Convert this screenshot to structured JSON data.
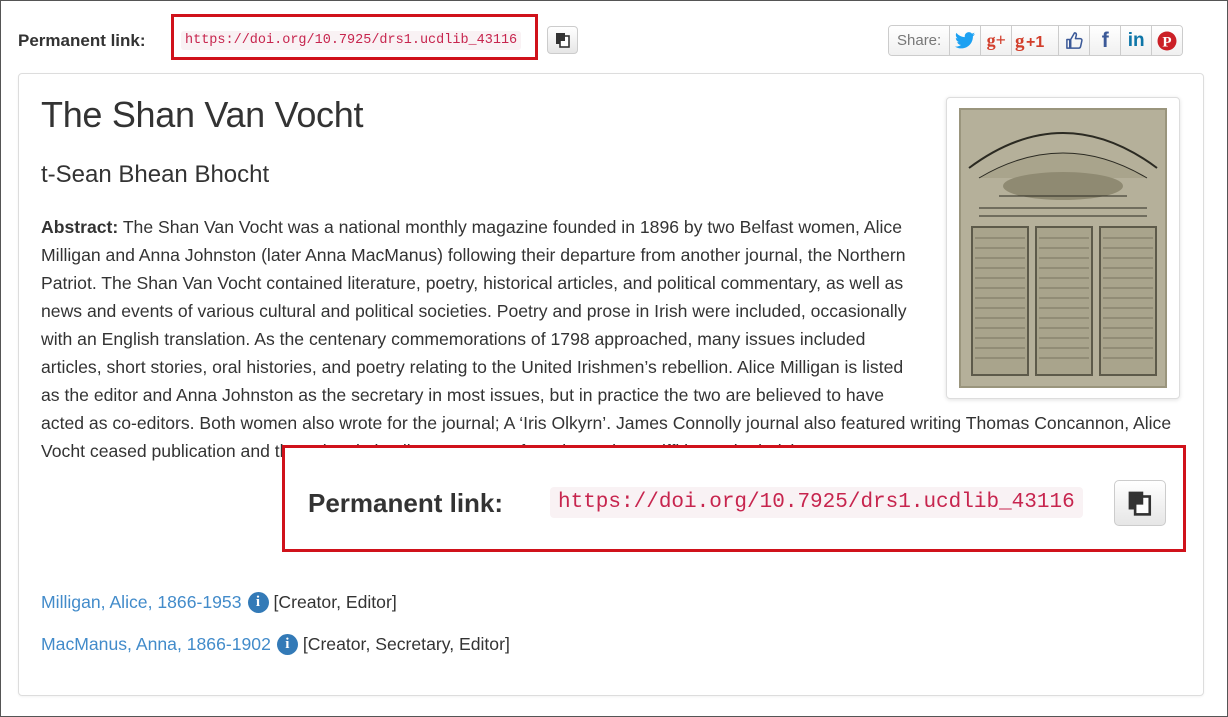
{
  "permalink": {
    "label": "Permanent link:",
    "url": "https://doi.org/10.7925/drs1.ucdlib_43116"
  },
  "share": {
    "label": "Share:",
    "buttons": [
      {
        "icon": "twitter-icon",
        "glyph": "",
        "color": "#1da1f2"
      },
      {
        "icon": "google-plus-icon",
        "glyph": "g+",
        "color": "#d23e2b"
      },
      {
        "icon": "google-plus-one-icon",
        "glyph": "+1",
        "color": "#d23e2b"
      },
      {
        "icon": "thumbs-up-icon",
        "glyph": "",
        "color": "#3b5998"
      },
      {
        "icon": "facebook-icon",
        "glyph": "f",
        "color": "#3b5998"
      },
      {
        "icon": "linkedin-icon",
        "glyph": "in",
        "color": "#0e76a8"
      },
      {
        "icon": "pinterest-icon",
        "glyph": "",
        "color": "#cb2027"
      }
    ]
  },
  "record": {
    "title": "The Shan Van Vocht",
    "subtitle": "t-Sean Bhean Bhocht",
    "abstract_label": "Abstract:",
    "abstract_text": "The Shan Van Vocht was a national monthly magazine founded in 1896 by two Belfast women, Alice Milligan and Anna Johnston (later Anna MacManus) following their departure from another journal, the Northern Patriot. The Shan Van Vocht contained literature, poetry, historical articles, and political commentary, as well as news and events of various cultural and political societies. Poetry and prose in Irish were included, occasionally with an English translation. As the centenary commemorations of 1798 approached, many issues included articles, short stories, oral histories, and poetry relating to the United Irishmen’s rebellion. Alice Milligan is listed as the editor and Anna Johnston as the secretary in most issues, but in practice the two are believed to have acted as co-editors. Both women also wrote for the journal; A                                                                          ‘Iris Olkyrn’. James Connolly                                                                                              journal also featured writing                                                                                                Thomas Concannon, Alice                                                                                                         Vocht ceased publication and the subscription lists were transferred to Arthur Griffith’s United Irishman.",
    "creators": [
      {
        "name": "Milligan, Alice, 1866-1953",
        "roles": "[Creator, Editor]"
      },
      {
        "name": "MacManus, Anna, 1866-1902",
        "roles": "[Creator, Secretary, Editor]"
      }
    ]
  },
  "colors": {
    "highlight": "#d0121b",
    "link": "#428bca",
    "code": "#c7254e"
  }
}
